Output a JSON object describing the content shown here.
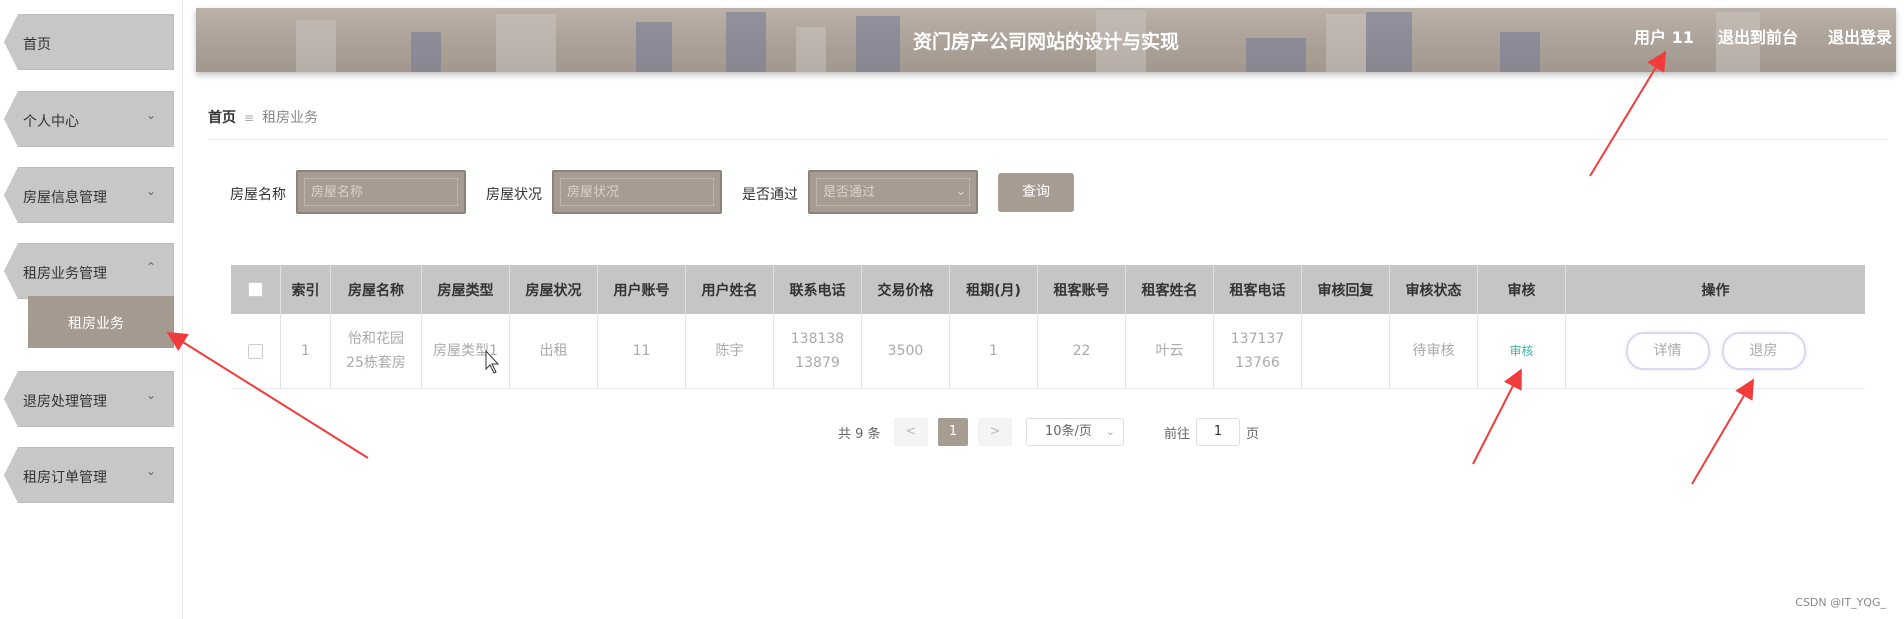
{
  "sidebar": {
    "items": [
      {
        "label": "首页",
        "chevron": ""
      },
      {
        "label": "个人中心",
        "chevron": "⌄"
      },
      {
        "label": "房屋信息管理",
        "chevron": "⌄"
      },
      {
        "label": "租房业务管理",
        "chevron": "⌃"
      },
      {
        "label": "退房处理管理",
        "chevron": "⌄"
      },
      {
        "label": "租房订单管理",
        "chevron": "⌄"
      }
    ],
    "submenu_active": "租房业务"
  },
  "header": {
    "title": "资门房产公司网站的设计与实现",
    "user": "用户 11",
    "back_front": "退出到前台",
    "logout": "退出登录"
  },
  "breadcrumb": {
    "home": "首页",
    "separator": "≡",
    "current": "租房业务"
  },
  "search": {
    "house_name_label": "房屋名称",
    "house_name_placeholder": "房屋名称",
    "house_status_label": "房屋状况",
    "house_status_placeholder": "房屋状况",
    "passed_label": "是否通过",
    "passed_placeholder": "是否通过",
    "query_button": "查询"
  },
  "table": {
    "headers": [
      "",
      "索引",
      "房屋名称",
      "房屋类型",
      "房屋状况",
      "用户账号",
      "用户姓名",
      "联系电话",
      "交易价格",
      "租期(月)",
      "租客账号",
      "租客姓名",
      "租客电话",
      "审核回复",
      "审核状态",
      "审核",
      "操作"
    ],
    "rows": [
      {
        "index": "1",
        "house_name": "怡和花园25栋套房",
        "house_type": "房屋类型1",
        "house_status": "出租",
        "user_account": "11",
        "user_name": "陈宇",
        "phone": "13813813879",
        "price": "3500",
        "lease": "1",
        "tenant_account": "22",
        "tenant_name": "叶云",
        "tenant_phone": "13713713766",
        "audit_reply": "",
        "audit_status": "待审核",
        "audit_link": "审核",
        "detail_button": "详情",
        "checkout_button": "退房"
      }
    ]
  },
  "pagination": {
    "total": "共 9 条",
    "prev": "<",
    "page": "1",
    "next": ">",
    "page_size": "10条/页",
    "goto_label": "前往",
    "goto_value": "1",
    "page_suffix": "页"
  },
  "watermark": "CSDN @IT_YQG_",
  "colors": {
    "accent": "#a79c91",
    "header_bg": "#aba097",
    "sidebar_item": "#c7c7c7",
    "table_header": "#c5c5c5",
    "audit_link": "#3cb4a3",
    "annotation_arrow": "#f23c3c"
  }
}
